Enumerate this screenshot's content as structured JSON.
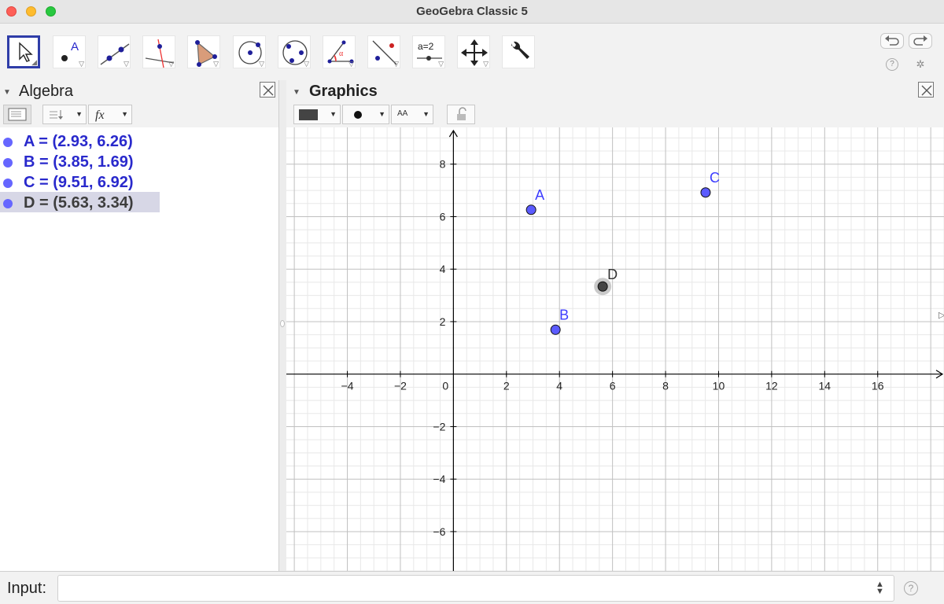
{
  "window": {
    "title": "GeoGebra Classic 5"
  },
  "toolbar": {
    "tools": [
      {
        "name": "move-tool",
        "icon": "arrow-pointer-icon",
        "selected": true
      },
      {
        "name": "point-tool",
        "icon": "point-icon",
        "label": "A"
      },
      {
        "name": "line-tool",
        "icon": "line-icon"
      },
      {
        "name": "perpendicular-line-tool",
        "icon": "perpendicular-line-icon"
      },
      {
        "name": "polygon-tool",
        "icon": "polygon-icon"
      },
      {
        "name": "circle-center-point-tool",
        "icon": "circle-center-icon"
      },
      {
        "name": "circle-three-points-tool",
        "icon": "circle-three-points-icon"
      },
      {
        "name": "angle-tool",
        "icon": "angle-icon",
        "label": "α"
      },
      {
        "name": "reflect-tool",
        "icon": "reflect-line-icon"
      },
      {
        "name": "slider-tool",
        "icon": "slider-icon",
        "label": "a=2"
      },
      {
        "name": "move-graphics-tool",
        "icon": "move-cross-icon"
      },
      {
        "name": "customize-toolbar",
        "icon": "wrench-icon"
      }
    ]
  },
  "algebra": {
    "title": "Algebra",
    "objects": [
      {
        "text": "A = (2.93, 6.26)",
        "selected": false
      },
      {
        "text": "B = (3.85, 1.69)",
        "selected": false
      },
      {
        "text": "C = (9.51, 6.92)",
        "selected": false
      },
      {
        "text": "D = (5.63, 3.34)",
        "selected": true
      }
    ]
  },
  "graphics": {
    "title": "Graphics",
    "stylebar": {
      "font_button": "AA"
    },
    "axes": {
      "x_ticks": [
        -4,
        -2,
        0,
        2,
        4,
        6,
        8,
        10,
        12,
        14,
        16
      ],
      "y_ticks": [
        8,
        6,
        4,
        2,
        -2,
        -4,
        -6
      ],
      "x_range": [
        -6.3,
        18.5
      ],
      "y_range": [
        -7.5,
        9.4
      ]
    },
    "points": [
      {
        "label": "A",
        "x": 2.93,
        "y": 6.26,
        "color": "#5b5bff",
        "selected": false
      },
      {
        "label": "B",
        "x": 3.85,
        "y": 1.69,
        "color": "#5b5bff",
        "selected": false
      },
      {
        "label": "C",
        "x": 9.51,
        "y": 6.92,
        "color": "#5b5bff",
        "selected": false
      },
      {
        "label": "D",
        "x": 5.63,
        "y": 3.34,
        "color": "#444444",
        "selected": true
      }
    ],
    "colors": {
      "point": "#5b5bff",
      "label": "#3c3cff",
      "selected_point": "#444444",
      "grid_major": "#c0c0c0",
      "grid_minor": "#e8e8e8",
      "axis": "#000000"
    }
  },
  "input_bar": {
    "label": "Input:",
    "value": ""
  }
}
